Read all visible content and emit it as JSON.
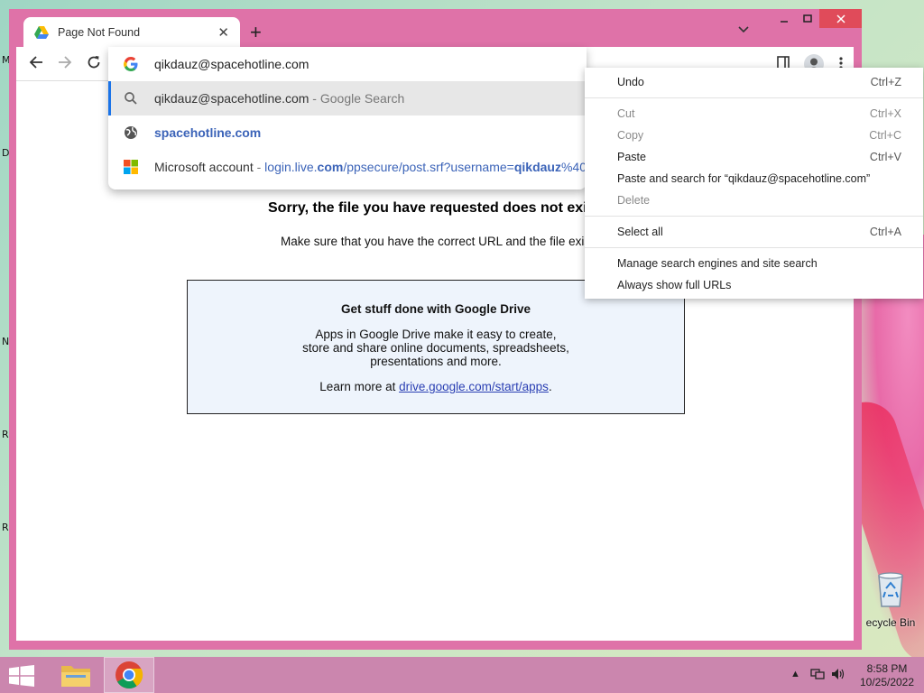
{
  "browser": {
    "tab_title": "Page Not Found",
    "address_text": "qikdauz@spacehotline.com"
  },
  "omnibox": {
    "suggestions": [
      {
        "main": "qikdauz@spacehotline.com",
        "sep": " - ",
        "secondary": "Google Search"
      },
      {
        "main": "spacehotline.com"
      },
      {
        "main": "Microsoft account",
        "sep": " - ",
        "url_a": "login.live.",
        "url_b": "com",
        "url_c": "/ppsecure/post.srf?username=",
        "url_d": "qikdauz",
        "url_e": "%40"
      }
    ]
  },
  "page": {
    "heading": "Sorry, the file you have requested does not exi",
    "subtext": "Make sure that you have the correct URL and the file exists",
    "drive_box": {
      "title": "Get stuff done with Google Drive",
      "body": "Apps in Google Drive make it easy to create, store and share online documents, spreadsheets, presentations and more.",
      "learn_more_prefix": "Learn more at ",
      "learn_more_link": "drive.google.com/start/apps",
      "learn_more_suffix": "."
    }
  },
  "context_menu": {
    "undo": {
      "label": "Undo",
      "shortcut": "Ctrl+Z"
    },
    "cut": {
      "label": "Cut",
      "shortcut": "Ctrl+X"
    },
    "copy": {
      "label": "Copy",
      "shortcut": "Ctrl+C"
    },
    "paste": {
      "label": "Paste",
      "shortcut": "Ctrl+V"
    },
    "paste_search": {
      "label": "Paste and search for “qikdauz@spacehotline.com”"
    },
    "delete": {
      "label": "Delete"
    },
    "select_all": {
      "label": "Select all",
      "shortcut": "Ctrl+A"
    },
    "manage_search": {
      "label": "Manage search engines and site search"
    },
    "show_urls": {
      "label": "Always show full URLs"
    }
  },
  "desktop": {
    "edge_letters": [
      "M",
      "D",
      "N",
      "R",
      "R"
    ],
    "recycle_label": "ecycle Bin"
  },
  "taskbar": {
    "time": "8:58 PM",
    "date": "10/25/2022"
  },
  "colors": {
    "window_frame": "#df72a8",
    "close_button": "#e04b5a",
    "taskbar": "#cb86ae",
    "link_blue": "#3b63b8",
    "selection_accent": "#1a73e8",
    "drive_box_bg": "#eef4fc"
  },
  "icons": {
    "tab_favicon": "google-drive-icon",
    "omnibox_search": "google-g-icon",
    "suggestion_search": "search-icon",
    "suggestion_site": "globe-icon",
    "suggestion_ms": "microsoft-icon"
  }
}
